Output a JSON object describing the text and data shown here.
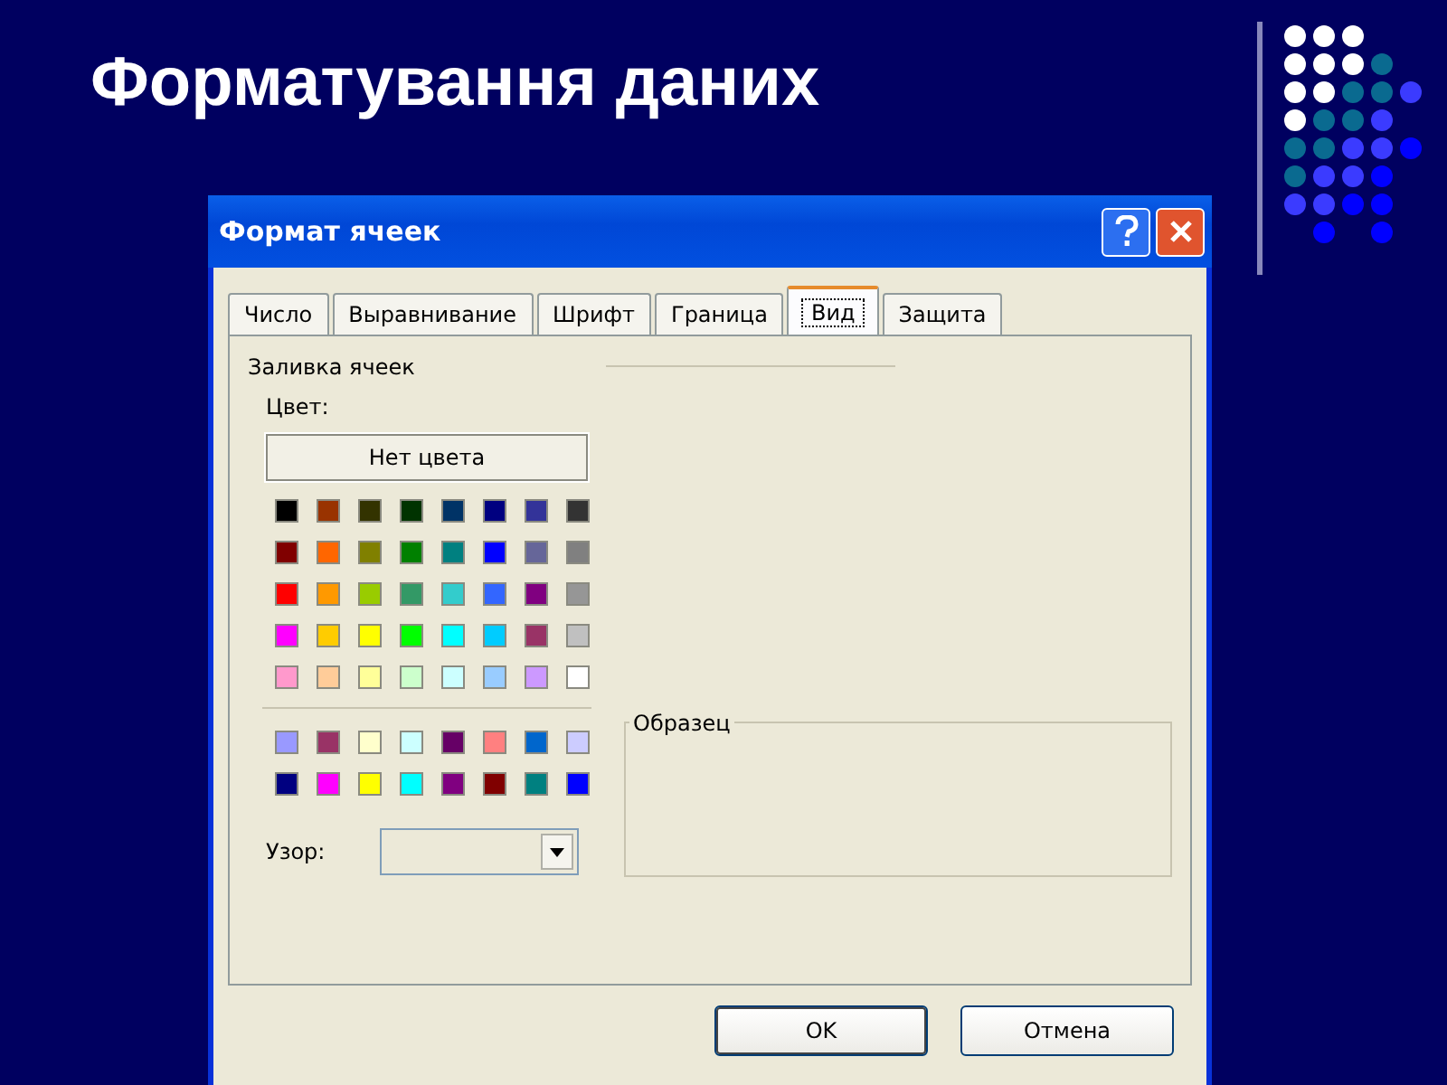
{
  "slide": {
    "title": "Форматування даних"
  },
  "window": {
    "title": "Формат ячеек"
  },
  "tabs": [
    {
      "label": "Число",
      "selected": false
    },
    {
      "label": "Выравнивание",
      "selected": false
    },
    {
      "label": "Шрифт",
      "selected": false
    },
    {
      "label": "Граница",
      "selected": false
    },
    {
      "label": "Вид",
      "selected": true
    },
    {
      "label": "Защита",
      "selected": false
    }
  ],
  "fill_group": {
    "title": "Заливка ячеек",
    "color_label": "Цвет:",
    "no_color_button": "Нет цвета",
    "palette": [
      [
        {
          "color": "#000000"
        },
        {
          "color": "#993300"
        },
        {
          "color": "#333300"
        },
        {
          "color": "#003300"
        },
        {
          "color": "#003366"
        },
        {
          "color": "#000080"
        },
        {
          "color": "#333399"
        },
        {
          "color": "#333333"
        }
      ],
      [
        {
          "color": "#800000"
        },
        {
          "color": "#ff6600"
        },
        {
          "color": "#808000"
        },
        {
          "color": "#008000"
        },
        {
          "color": "#008080"
        },
        {
          "color": "#0000ff"
        },
        {
          "color": "#666699"
        },
        {
          "color": "#808080"
        }
      ],
      [
        {
          "color": "#ff0000"
        },
        {
          "color": "#ff9900"
        },
        {
          "color": "#99cc00"
        },
        {
          "color": "#339966"
        },
        {
          "color": "#33cccc"
        },
        {
          "color": "#3366ff"
        },
        {
          "color": "#800080"
        },
        {
          "color": "#969696"
        }
      ],
      [
        {
          "color": "#ff00ff"
        },
        {
          "color": "#ffcc00"
        },
        {
          "color": "#ffff00"
        },
        {
          "color": "#00ff00"
        },
        {
          "color": "#00ffff"
        },
        {
          "color": "#00ccff"
        },
        {
          "color": "#993366"
        },
        {
          "color": "#c0c0c0"
        }
      ],
      [
        {
          "color": "#ff99cc"
        },
        {
          "color": "#ffcc99"
        },
        {
          "color": "#ffff99"
        },
        {
          "color": "#ccffcc"
        },
        {
          "color": "#ccffff"
        },
        {
          "color": "#99ccff"
        },
        {
          "color": "#cc99ff"
        },
        {
          "color": "#ffffff"
        }
      ]
    ],
    "chart_palette": [
      [
        {
          "color": "#9999ff"
        },
        {
          "color": "#993366"
        },
        {
          "color": "#ffffcc"
        },
        {
          "color": "#ccffff"
        },
        {
          "color": "#660066"
        },
        {
          "color": "#ff8080"
        },
        {
          "color": "#0066cc"
        },
        {
          "color": "#ccccff"
        }
      ],
      [
        {
          "color": "#000080"
        },
        {
          "color": "#ff00ff"
        },
        {
          "color": "#ffff00"
        },
        {
          "color": "#00ffff"
        },
        {
          "color": "#800080"
        },
        {
          "color": "#800000"
        },
        {
          "color": "#008080"
        },
        {
          "color": "#0000ff"
        }
      ]
    ],
    "pattern_label": "Узор:"
  },
  "sample": {
    "title": "Образец"
  },
  "buttons": [
    {
      "label": "OK",
      "default": true
    },
    {
      "label": "Отмена",
      "default": false
    }
  ]
}
